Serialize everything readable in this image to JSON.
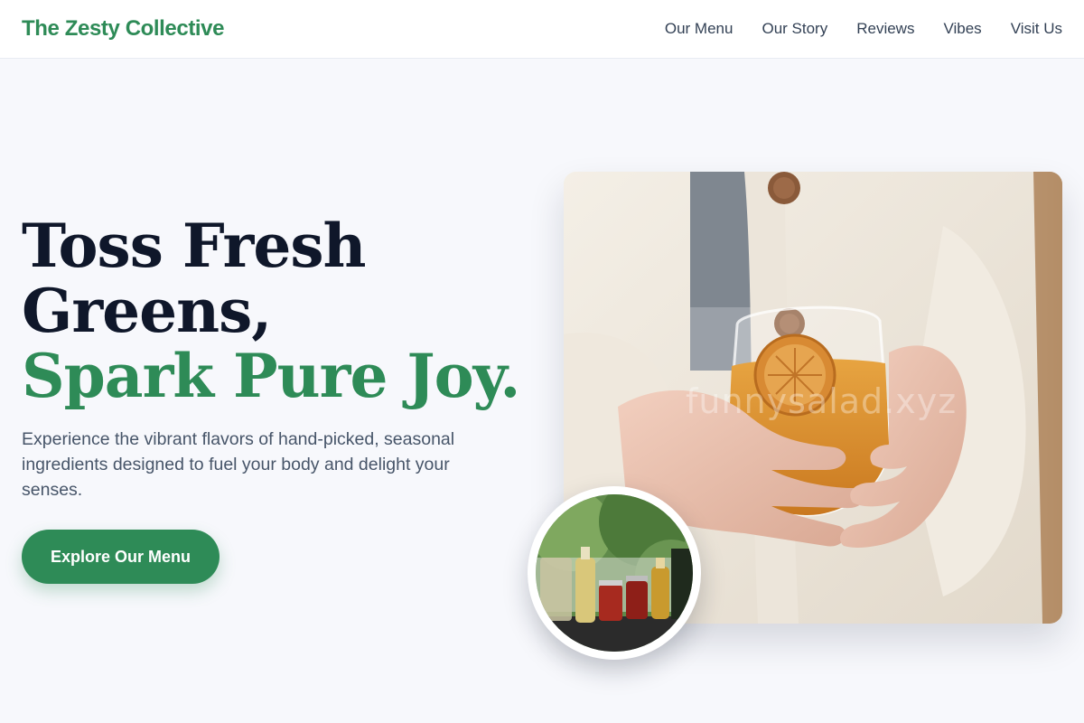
{
  "header": {
    "brand": "The Zesty Collective",
    "nav": [
      "Our Menu",
      "Our Story",
      "Reviews",
      "Vibes",
      "Visit Us"
    ]
  },
  "hero": {
    "headline_line1": "Toss Fresh",
    "headline_line2": "Greens,",
    "headline_accent": "Spark Pure Joy.",
    "subtext": "Experience the vibrant flavors of hand-picked, seasonal ingredients designed to fuel your body and delight your senses.",
    "cta_label": "Explore Our Menu"
  },
  "images": {
    "main_watermark": "funnysalad.xyz"
  },
  "colors": {
    "accent": "#2e8b57",
    "heading": "#0f172a",
    "body_text": "#475569",
    "background": "#f7f8fc"
  }
}
